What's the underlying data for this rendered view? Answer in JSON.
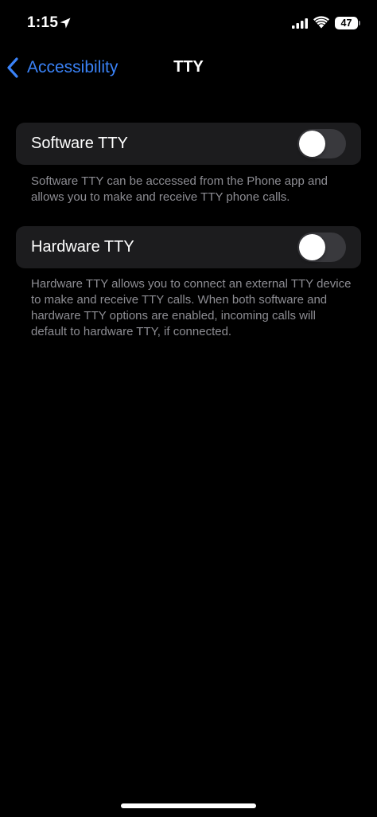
{
  "status_bar": {
    "time": "1:15",
    "battery_level": "47",
    "icons": [
      "location-arrow-icon",
      "cellular-signal-icon",
      "wifi-icon",
      "battery-icon"
    ]
  },
  "nav": {
    "back_label": "Accessibility",
    "title": "TTY",
    "accent_color": "#3a82f7"
  },
  "settings": [
    {
      "label": "Software TTY",
      "enabled": false,
      "footer": "Software TTY can be accessed from the Phone app and allows you to make and receive TTY phone calls."
    },
    {
      "label": "Hardware TTY",
      "enabled": false,
      "footer": "Hardware TTY allows you to connect an external TTY device to make and receive TTY calls. When both software and hardware TTY options are enabled, incoming calls will default to hardware TTY, if connected."
    }
  ],
  "colors": {
    "background": "#000000",
    "group_background": "#1c1c1e",
    "toggle_off": "#39393d",
    "footer_text": "#8d8d93"
  }
}
